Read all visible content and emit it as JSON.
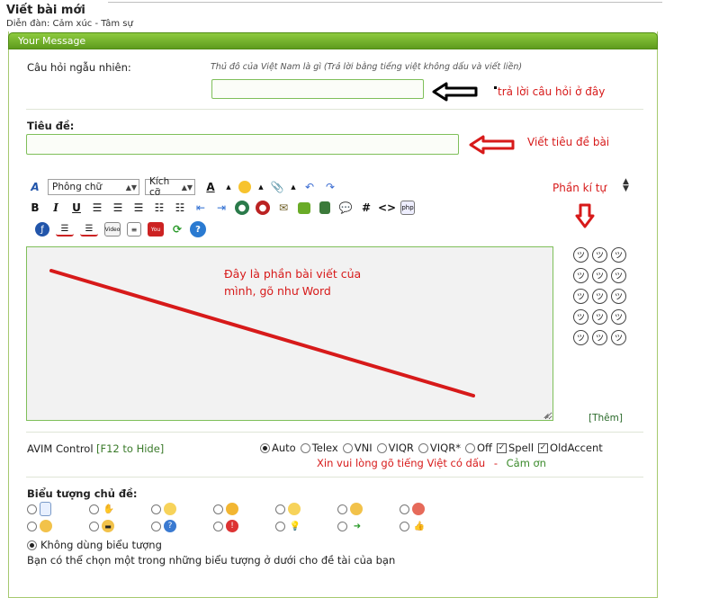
{
  "header": {
    "page_title": "Viết bài mới",
    "breadcrumb": "Diễn đàn: Cảm xúc - Tâm sự"
  },
  "panel": {
    "title": "Your Message"
  },
  "question": {
    "label": "Câu hỏi ngẫu nhiên:",
    "hint": "Thủ đô của Việt Nam là gì (Trả lời bằng tiếng việt không dấu và viết liền)",
    "answer_value": "",
    "annotation": "trả lời câu hỏi ở đây"
  },
  "subject": {
    "label": "Tiêu đề:",
    "value": "",
    "annotation": "Viết tiêu đề bài"
  },
  "toolbar": {
    "font_select": "Phông chữ",
    "size_select": "Kích cỡ",
    "bold": "B",
    "italic": "I",
    "underline": "U",
    "hash": "#",
    "code": "<>"
  },
  "editor": {
    "annotation_line1": "Đây là phần bài viết của",
    "annotation_line2": "mình, gõ như Word"
  },
  "smilies": {
    "annotation": "Phần kí tự",
    "more_link": "[Thêm]",
    "items": [
      "smiley-1",
      "smiley-2",
      "smiley-3",
      "smiley-4",
      "smiley-5",
      "smiley-6",
      "smiley-7",
      "smiley-8",
      "smiley-9",
      "smiley-10",
      "smiley-11",
      "smiley-12",
      "smiley-13",
      "smiley-14",
      "smiley-15"
    ]
  },
  "avim": {
    "label": "AVIM Control",
    "hide_hint": "[F12 to Hide]",
    "options": [
      "Auto",
      "Telex",
      "VNI",
      "VIQR",
      "VIQR*",
      "Off"
    ],
    "selected": "Auto",
    "spell_label": "Spell",
    "oldaccent_label": "OldAccent",
    "note": "Xin vui lòng gõ tiếng Việt có dấu",
    "note_sep": "-",
    "thanks": "Cảm ơn"
  },
  "post_icons": {
    "label": "Biểu tượng chủ đề:",
    "none_label": "Không dùng biểu tượng",
    "help_text": "Bạn có thể chọn một trong những biểu tượng ở dưới cho đề tài của bạn"
  },
  "colors": {
    "accent_green": "#6aab27",
    "annotation_red": "#d71a1a",
    "input_border": "#7fbf5a"
  }
}
